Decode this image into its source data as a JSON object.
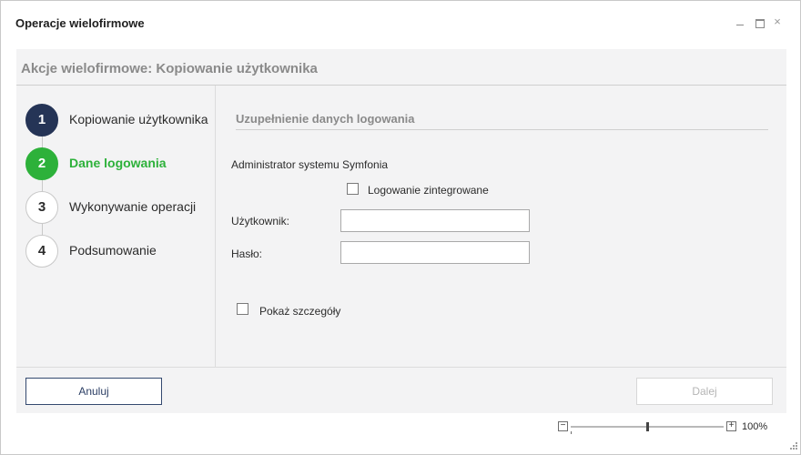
{
  "window": {
    "title": "Operacje wielofirmowe",
    "controls": {
      "minimize": "minimize-icon",
      "maximize": "maximize-icon",
      "close": "×"
    }
  },
  "header": {
    "title": "Akcje wielofirmowe: Kopiowanie użytkownika"
  },
  "steps": [
    {
      "number": "1",
      "label": "Kopiowanie użytkownika",
      "state": "done"
    },
    {
      "number": "2",
      "label": "Dane logowania",
      "state": "active"
    },
    {
      "number": "3",
      "label": "Wykonywanie operacji",
      "state": "todo"
    },
    {
      "number": "4",
      "label": "Podsumowanie",
      "state": "todo"
    }
  ],
  "form": {
    "section_title": "Uzupełnienie danych logowania",
    "admin_label": "Administrator systemu Symfonia",
    "integrated_login_label": "Logowanie zintegrowane",
    "integrated_login_checked": false,
    "user_label": "Użytkownik:",
    "user_value": "",
    "password_label": "Hasło:",
    "password_value": "",
    "show_details_label": "Pokaż szczegóły",
    "show_details_checked": false
  },
  "footer": {
    "cancel_label": "Anuluj",
    "next_label": "Dalej",
    "next_enabled": false
  },
  "zoom": {
    "level_label": "100%",
    "minus": "−",
    "plus": "+"
  },
  "colors": {
    "done": "#253456",
    "active": "#2db13a",
    "accent": "#34496f"
  }
}
